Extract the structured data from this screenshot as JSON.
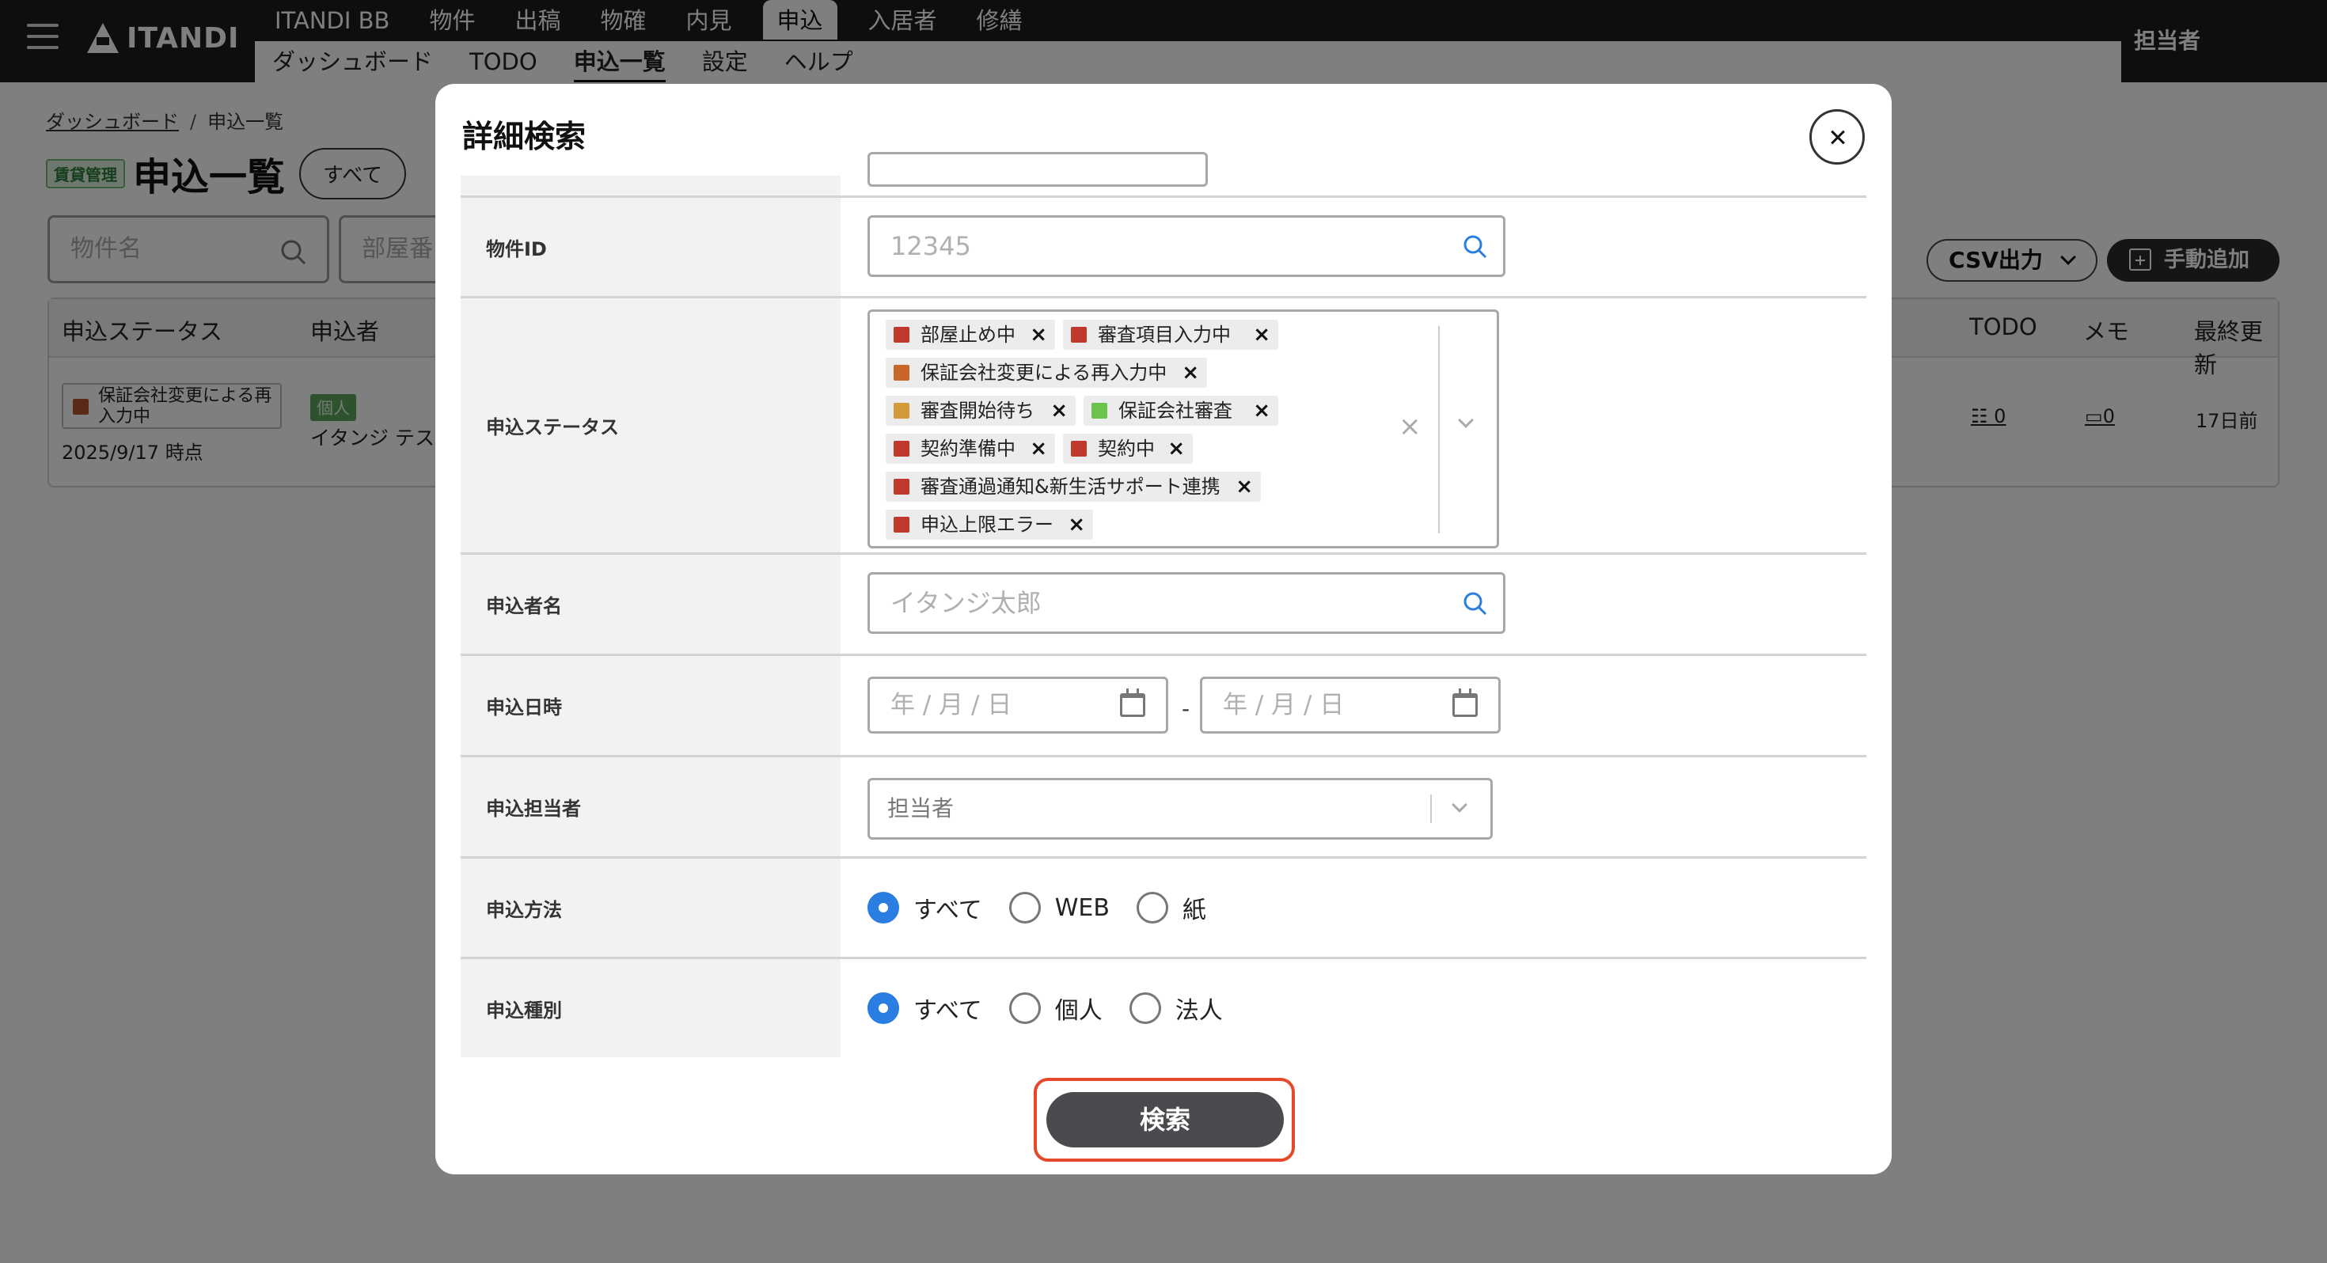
{
  "topbar": {
    "logo": "ITANDI",
    "gnav": [
      "ITANDI BB",
      "物件",
      "出稿",
      "物確",
      "内見",
      "申込",
      "入居者",
      "修繕"
    ],
    "subnav": [
      "ダッシュボード",
      "TODO",
      "申込一覧",
      "設定",
      "ヘルプ"
    ],
    "user": "担当者"
  },
  "page": {
    "breadcrumb": [
      "ダッシュボード",
      "申込一覧"
    ],
    "tag": "賃貸管理",
    "title": "申込一覧",
    "chip": "すべて",
    "search_property_placeholder": "物件名",
    "search_room_placeholder": "部屋番",
    "csv_button": "CSV出力",
    "add_button": "手動追加",
    "table": {
      "headers": [
        "申込ステータス",
        "申込者",
        "TODO",
        "メモ",
        "最終更新"
      ],
      "row": {
        "status": "保証会社変更による再入力中",
        "date": "2025/9/17 時点",
        "type": "個人",
        "applicant": "イタンジ テスト",
        "todo": "0",
        "memo": "0",
        "updated": "17日前"
      }
    }
  },
  "modal": {
    "title": "詳細検索",
    "fields": {
      "property_id": {
        "label": "物件ID",
        "placeholder": "12345"
      },
      "status": {
        "label": "申込ステータス",
        "tags": [
          {
            "text": "部屋止め中",
            "color": "#c0392b"
          },
          {
            "text": "審査項目入力中",
            "color": "#c0392b"
          },
          {
            "text": "保証会社変更による再入力中",
            "color": "#c9672a"
          },
          {
            "text": "審査開始待ち",
            "color": "#d39a3a"
          },
          {
            "text": "保証会社審査",
            "color": "#6ac34b"
          },
          {
            "text": "契約準備中",
            "color": "#c0392b"
          },
          {
            "text": "契約中",
            "color": "#c0392b"
          },
          {
            "text": "審査通過通知&新生活サポート連携",
            "color": "#c0392b"
          },
          {
            "text": "申込上限エラー",
            "color": "#c0392b"
          }
        ]
      },
      "applicant_name": {
        "label": "申込者名",
        "placeholder": "イタンジ太郎"
      },
      "applied_at": {
        "label": "申込日時",
        "placeholder": "年 / 月 / 日",
        "separator": "-"
      },
      "assignee": {
        "label": "申込担当者",
        "placeholder": "担当者"
      },
      "method": {
        "label": "申込方法",
        "options": [
          "すべて",
          "WEB",
          "紙"
        ],
        "selected": "すべて"
      },
      "kind": {
        "label": "申込種別",
        "options": [
          "すべて",
          "個人",
          "法人"
        ],
        "selected": "すべて"
      }
    },
    "search_button": "検索"
  },
  "colors": {
    "accent_blue": "#2a7de1",
    "highlight_red": "#e5492a"
  }
}
